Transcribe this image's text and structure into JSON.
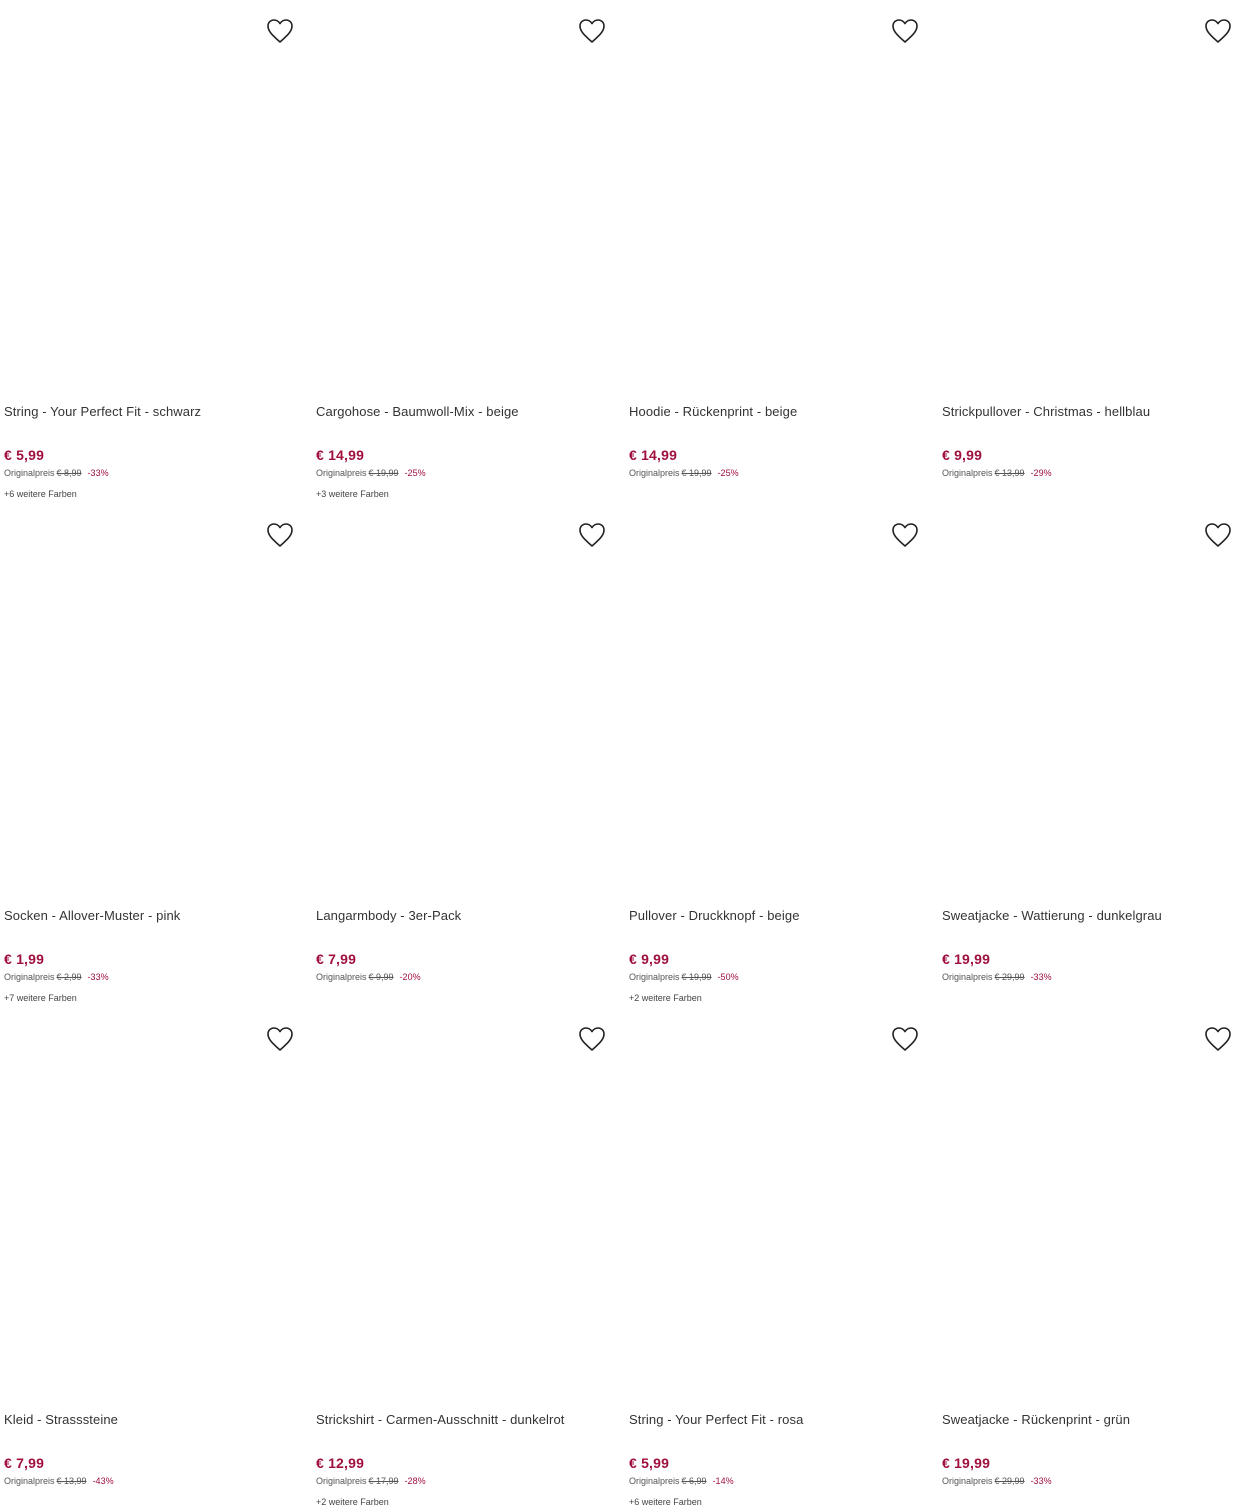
{
  "favorite_icon": "heart-outline-icon",
  "colors": {
    "price": "#a0103c",
    "text": "#333333"
  },
  "products": [
    {
      "title": "String - Your Perfect Fit - schwarz",
      "price": "€ 5,99",
      "orig_label": "Originalpreis",
      "orig_price": "€ 8,99",
      "discount": "-33%",
      "more_colors": "+6 weitere Farben"
    },
    {
      "title": "Cargohose - Baumwoll-Mix - beige",
      "price": "€ 14,99",
      "orig_label": "Originalpreis",
      "orig_price": "€ 19,99",
      "discount": "-25%",
      "more_colors": "+3 weitere Farben"
    },
    {
      "title": "Hoodie - Rückenprint - beige",
      "price": "€ 14,99",
      "orig_label": "Originalpreis",
      "orig_price": "€ 19,99",
      "discount": "-25%",
      "more_colors": ""
    },
    {
      "title": "Strickpullover - Christmas - hellblau",
      "price": "€ 9,99",
      "orig_label": "Originalpreis",
      "orig_price": "€ 13,99",
      "discount": "-29%",
      "more_colors": ""
    },
    {
      "title": "Socken - Allover-Muster - pink",
      "price": "€ 1,99",
      "orig_label": "Originalpreis",
      "orig_price": "€ 2,99",
      "discount": "-33%",
      "more_colors": "+7 weitere Farben"
    },
    {
      "title": "Langarmbody - 3er-Pack",
      "price": "€ 7,99",
      "orig_label": "Originalpreis",
      "orig_price": "€ 9,99",
      "discount": "-20%",
      "more_colors": ""
    },
    {
      "title": "Pullover - Druckknopf - beige",
      "price": "€ 9,99",
      "orig_label": "Originalpreis",
      "orig_price": "€ 19,99",
      "discount": "-50%",
      "more_colors": "+2 weitere Farben"
    },
    {
      "title": "Sweatjacke - Wattierung - dunkelgrau",
      "price": "€ 19,99",
      "orig_label": "Originalpreis",
      "orig_price": "€ 29,99",
      "discount": "-33%",
      "more_colors": ""
    },
    {
      "title": "Kleid - Strasssteine",
      "price": "€ 7,99",
      "orig_label": "Originalpreis",
      "orig_price": "€ 13,99",
      "discount": "-43%",
      "more_colors": ""
    },
    {
      "title": "Strickshirt - Carmen-Ausschnitt - dunkelrot",
      "price": "€ 12,99",
      "orig_label": "Originalpreis",
      "orig_price": "€ 17,99",
      "discount": "-28%",
      "more_colors": "+2 weitere Farben"
    },
    {
      "title": "String - Your Perfect Fit - rosa",
      "price": "€ 5,99",
      "orig_label": "Originalpreis",
      "orig_price": "€ 6,99",
      "discount": "-14%",
      "more_colors": "+6 weitere Farben"
    },
    {
      "title": "Sweatjacke - Rückenprint - grün",
      "price": "€ 19,99",
      "orig_label": "Originalpreis",
      "orig_price": "€ 29,99",
      "discount": "-33%",
      "more_colors": ""
    }
  ]
}
